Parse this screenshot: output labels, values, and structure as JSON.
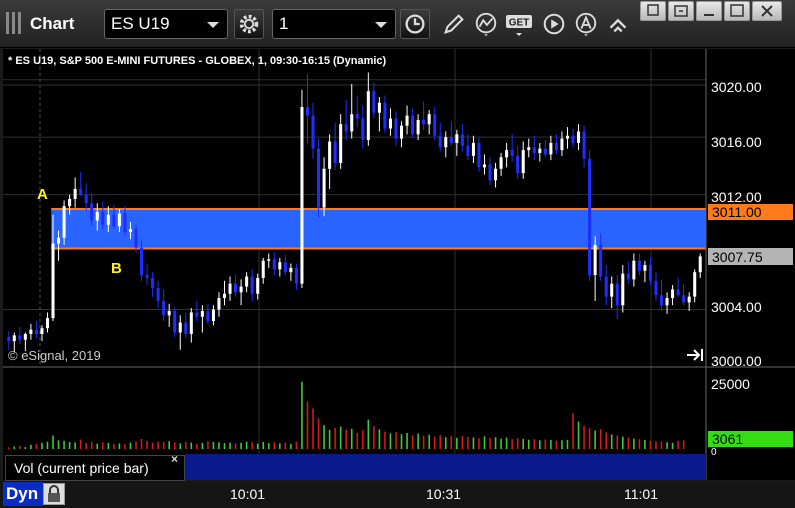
{
  "window": {
    "title": "Chart",
    "symbol": "ES U19",
    "interval": "1",
    "buttons": [
      "minimize-to-tray",
      "restore",
      "maximize",
      "close"
    ]
  },
  "toolbar": {
    "icons": [
      "settings-icon",
      "clock-icon",
      "draw-icon",
      "study-icon",
      "get-icon",
      "play-icon",
      "cursor-icon",
      "link-icon"
    ],
    "get_label": "GET"
  },
  "chart": {
    "subtitle": "* ES U19, S&P 500 E-MINI FUTURES - GLOBEX, 1, 09:30-16:15 (Dynamic)",
    "copyright": "© eSignal, 2019",
    "colors": {
      "up": "#ffffff",
      "down": "#1e2eff",
      "band": "#2a64ff",
      "zone_line": "#ff7a18",
      "vol_up": "#3ec93e",
      "vol_down": "#d51818"
    }
  },
  "zone": {
    "label_a": "A",
    "label_b": "B",
    "upper_value": "3011.00",
    "lower_value": "3008.25",
    "last_price": "3007.75"
  },
  "price_axis": {
    "ticks": [
      "3020.00",
      "3016.00",
      "3012.00",
      "3004.00",
      "3000.00"
    ],
    "range": [
      3000,
      3022
    ]
  },
  "volume": {
    "label": "Vol (current price bar)",
    "current": "3061",
    "max_tick": "25000",
    "min_tick": "0"
  },
  "time_axis": {
    "labels": [
      "10:01",
      "10:31",
      "11:01"
    ]
  },
  "status": {
    "mode": "Dyn"
  },
  "chart_data": {
    "type": "candlestick",
    "ylim": [
      3000,
      3022
    ],
    "candles": [
      [
        3002.1,
        3002.5,
        3001.2,
        3001.8
      ],
      [
        3001.8,
        3002.4,
        3001.0,
        3002.2
      ],
      [
        3002.2,
        3002.8,
        3001.6,
        3001.9
      ],
      [
        3001.9,
        3002.4,
        3001.1,
        3002.3
      ],
      [
        3002.3,
        3003.0,
        3001.9,
        3002.6
      ],
      [
        3002.6,
        3003.2,
        3002.0,
        3002.3
      ],
      [
        3002.3,
        3002.9,
        3001.8,
        3002.7
      ],
      [
        3002.7,
        3003.8,
        3002.4,
        3003.4
      ],
      [
        3003.4,
        3010.6,
        3003.2,
        3008.6
      ],
      [
        3008.6,
        3009.5,
        3007.4,
        3009.0
      ],
      [
        3009.0,
        3011.6,
        3008.5,
        3011.2
      ],
      [
        3011.2,
        3012.0,
        3010.6,
        3011.7
      ],
      [
        3011.7,
        3013.2,
        3011.1,
        3012.4
      ],
      [
        3012.4,
        3013.6,
        3011.9,
        3012.0
      ],
      [
        3012.0,
        3012.8,
        3010.9,
        3011.4
      ],
      [
        3011.4,
        3012.1,
        3009.8,
        3010.2
      ],
      [
        3010.2,
        3011.4,
        3009.5,
        3010.8
      ],
      [
        3010.8,
        3011.5,
        3009.6,
        3009.9
      ],
      [
        3009.9,
        3011.2,
        3009.4,
        3010.6
      ],
      [
        3010.6,
        3011.3,
        3009.6,
        3009.8
      ],
      [
        3009.8,
        3011.0,
        3009.4,
        3010.7
      ],
      [
        3010.7,
        3011.2,
        3009.1,
        3009.4
      ],
      [
        3009.4,
        3010.1,
        3008.9,
        3009.6
      ],
      [
        3009.6,
        3009.9,
        3008.0,
        3008.3
      ],
      [
        3008.3,
        3008.9,
        3006.0,
        3006.4
      ],
      [
        3006.4,
        3007.2,
        3005.7,
        3006.2
      ],
      [
        3006.2,
        3006.6,
        3004.9,
        3005.5
      ],
      [
        3005.5,
        3006.0,
        3004.1,
        3004.6
      ],
      [
        3004.6,
        3005.4,
        3003.2,
        3003.6
      ],
      [
        3003.6,
        3004.4,
        3002.8,
        3003.9
      ],
      [
        3003.9,
        3004.2,
        3002.1,
        3002.4
      ],
      [
        3002.4,
        3003.6,
        3001.2,
        3003.1
      ],
      [
        3003.1,
        3003.8,
        3002.0,
        3002.3
      ],
      [
        3002.3,
        3004.1,
        3001.7,
        3003.8
      ],
      [
        3003.8,
        3004.6,
        3003.2,
        3003.5
      ],
      [
        3003.5,
        3004.3,
        3002.4,
        3003.9
      ],
      [
        3003.9,
        3004.4,
        3003.0,
        3003.2
      ],
      [
        3003.2,
        3004.3,
        3002.9,
        3004.0
      ],
      [
        3004.0,
        3005.2,
        3003.5,
        3004.8
      ],
      [
        3004.8,
        3006.0,
        3004.3,
        3005.1
      ],
      [
        3005.1,
        3006.3,
        3004.6,
        3005.8
      ],
      [
        3005.8,
        3006.4,
        3004.9,
        3005.2
      ],
      [
        3005.2,
        3006.1,
        3004.3,
        3005.6
      ],
      [
        3005.6,
        3006.6,
        3005.2,
        3006.3
      ],
      [
        3006.3,
        3006.8,
        3004.6,
        3005.1
      ],
      [
        3005.1,
        3006.5,
        3004.7,
        3006.2
      ],
      [
        3006.2,
        3007.6,
        3005.8,
        3007.4
      ],
      [
        3007.4,
        3007.9,
        3006.9,
        3007.5
      ],
      [
        3007.5,
        3008.0,
        3006.4,
        3006.8
      ],
      [
        3006.8,
        3007.6,
        3006.3,
        3007.3
      ],
      [
        3007.3,
        3007.8,
        3006.4,
        3006.6
      ],
      [
        3006.6,
        3007.2,
        3006.0,
        3006.9
      ],
      [
        3006.9,
        3007.2,
        3005.4,
        3005.8
      ],
      [
        3005.8,
        3019.3,
        3005.5,
        3018.1
      ],
      [
        3018.1,
        3020.4,
        3015.6,
        3017.5
      ],
      [
        3017.5,
        3018.4,
        3014.5,
        3015.2
      ],
      [
        3015.2,
        3015.9,
        3010.4,
        3011.1
      ],
      [
        3011.1,
        3014.6,
        3010.5,
        3013.8
      ],
      [
        3013.8,
        3016.2,
        3012.4,
        3015.7
      ],
      [
        3015.7,
        3017.0,
        3013.7,
        3014.2
      ],
      [
        3014.2,
        3017.6,
        3013.8,
        3016.9
      ],
      [
        3016.9,
        3018.6,
        3015.8,
        3016.4
      ],
      [
        3016.4,
        3019.7,
        3015.9,
        3017.6
      ],
      [
        3017.6,
        3018.9,
        3016.7,
        3017.3
      ],
      [
        3017.3,
        3018.2,
        3015.2,
        3015.8
      ],
      [
        3015.8,
        3020.5,
        3015.4,
        3019.2
      ],
      [
        3019.2,
        3019.8,
        3017.3,
        3017.7
      ],
      [
        3017.7,
        3018.8,
        3016.4,
        3018.4
      ],
      [
        3018.4,
        3018.9,
        3016.3,
        3016.6
      ],
      [
        3016.6,
        3018.0,
        3016.1,
        3017.3
      ],
      [
        3017.3,
        3017.8,
        3015.4,
        3015.9
      ],
      [
        3015.9,
        3017.1,
        3015.3,
        3016.8
      ],
      [
        3016.8,
        3018.2,
        3016.2,
        3017.5
      ],
      [
        3017.5,
        3018.0,
        3016.0,
        3016.2
      ],
      [
        3016.2,
        3017.6,
        3015.8,
        3017.2
      ],
      [
        3017.2,
        3018.5,
        3016.5,
        3016.9
      ],
      [
        3016.9,
        3017.9,
        3016.2,
        3017.6
      ],
      [
        3017.6,
        3018.1,
        3015.8,
        3016.1
      ],
      [
        3016.1,
        3017.0,
        3015.0,
        3015.3
      ],
      [
        3015.3,
        3016.4,
        3014.6,
        3016.0
      ],
      [
        3016.0,
        3017.1,
        3015.4,
        3015.6
      ],
      [
        3015.6,
        3016.5,
        3014.7,
        3016.2
      ],
      [
        3016.2,
        3016.9,
        3015.0,
        3015.4
      ],
      [
        3015.4,
        3016.2,
        3014.4,
        3014.7
      ],
      [
        3014.7,
        3016.1,
        3014.2,
        3015.6
      ],
      [
        3015.6,
        3016.0,
        3013.6,
        3013.9
      ],
      [
        3013.9,
        3014.8,
        3013.4,
        3014.1
      ],
      [
        3014.1,
        3014.6,
        3012.7,
        3013.0
      ],
      [
        3013.0,
        3014.2,
        3012.5,
        3013.8
      ],
      [
        3013.8,
        3014.9,
        3013.3,
        3014.6
      ],
      [
        3014.6,
        3015.6,
        3013.9,
        3015.1
      ],
      [
        3015.1,
        3016.2,
        3014.3,
        3014.7
      ],
      [
        3014.7,
        3015.4,
        3013.1,
        3013.5
      ],
      [
        3013.5,
        3015.7,
        3013.1,
        3015.1
      ],
      [
        3015.1,
        3015.9,
        3014.6,
        3015.3
      ],
      [
        3015.3,
        3016.1,
        3014.4,
        3014.9
      ],
      [
        3014.9,
        3015.6,
        3014.3,
        3015.2
      ],
      [
        3015.2,
        3015.8,
        3014.6,
        3014.8
      ],
      [
        3014.8,
        3016.1,
        3014.4,
        3015.6
      ],
      [
        3015.6,
        3016.2,
        3014.8,
        3015.1
      ],
      [
        3015.1,
        3016.4,
        3014.7,
        3015.9
      ],
      [
        3015.9,
        3016.7,
        3015.2,
        3016.1
      ],
      [
        3016.1,
        3016.6,
        3015.3,
        3015.6
      ],
      [
        3015.6,
        3016.9,
        3015.1,
        3016.4
      ],
      [
        3016.4,
        3016.8,
        3013.9,
        3014.5
      ],
      [
        3014.5,
        3015.1,
        3006.0,
        3006.4
      ],
      [
        3006.4,
        3009.1,
        3004.6,
        3008.5
      ],
      [
        3008.5,
        3009.3,
        3006.0,
        3006.3
      ],
      [
        3006.3,
        3007.1,
        3004.3,
        3004.9
      ],
      [
        3004.9,
        3006.3,
        3004.1,
        3005.8
      ],
      [
        3005.8,
        3006.4,
        3003.3,
        3004.3
      ],
      [
        3004.3,
        3007.1,
        3003.8,
        3006.5
      ],
      [
        3006.5,
        3007.3,
        3005.8,
        3006.1
      ],
      [
        3006.1,
        3007.9,
        3005.6,
        3007.4
      ],
      [
        3007.4,
        3007.9,
        3006.4,
        3006.7
      ],
      [
        3006.7,
        3007.4,
        3005.9,
        3007.1
      ],
      [
        3007.1,
        3007.6,
        3005.7,
        3006.0
      ],
      [
        3006.0,
        3006.6,
        3004.6,
        3005.0
      ],
      [
        3005.0,
        3006.1,
        3003.9,
        3004.3
      ],
      [
        3004.3,
        3005.2,
        3003.7,
        3004.8
      ],
      [
        3004.8,
        3005.7,
        3004.3,
        3005.4
      ],
      [
        3005.4,
        3006.2,
        3004.9,
        3005.0
      ],
      [
        3005.0,
        3005.8,
        3004.3,
        3004.5
      ],
      [
        3004.5,
        3005.2,
        3003.9,
        3004.9
      ],
      [
        3004.9,
        3006.8,
        3004.5,
        3006.6
      ],
      [
        3006.6,
        3007.9,
        3006.2,
        3007.7
      ]
    ],
    "volume": [
      620,
      900,
      1100,
      700,
      1500,
      1800,
      2200,
      2600,
      4800,
      3100,
      2900,
      2500,
      2300,
      3400,
      2100,
      2600,
      1900,
      2400,
      2200,
      1800,
      2000,
      1700,
      2300,
      2700,
      3600,
      2900,
      2300,
      2600,
      2500,
      2800,
      2400,
      2000,
      2600,
      2300,
      1900,
      2200,
      2700,
      2500,
      2400,
      2100,
      2300,
      2000,
      2200,
      2600,
      2400,
      1900,
      2500,
      2100,
      2400,
      2000,
      2300,
      1800,
      2600,
      24000,
      17000,
      14500,
      11000,
      8500,
      6800,
      7500,
      8000,
      6900,
      7200,
      5800,
      6700,
      10500,
      8200,
      7000,
      6200,
      5600,
      6000,
      5300,
      5700,
      4900,
      5500,
      4700,
      5100,
      4400,
      4900,
      4200,
      4600,
      4000,
      4700,
      4300,
      4100,
      3800,
      4500,
      3900,
      4200,
      3700,
      4100,
      3500,
      3900,
      3600,
      3300,
      3500,
      3100,
      3400,
      3200,
      3000,
      3100,
      3300,
      12800,
      9800,
      8200,
      7400,
      6600,
      7100,
      5900,
      5200,
      4800,
      4400,
      4100,
      3700,
      3500,
      3200,
      3000,
      2800,
      2600,
      2400,
      2200,
      2900,
      3061
    ]
  }
}
